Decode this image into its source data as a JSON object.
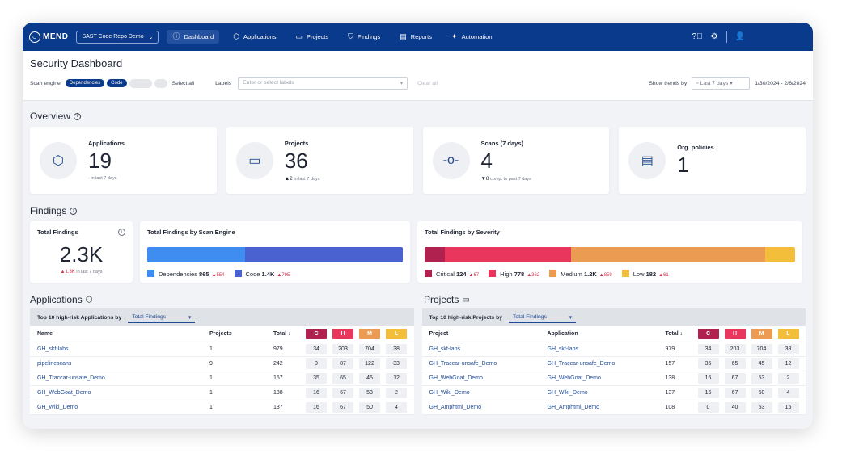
{
  "colors": {
    "brand": "#0a3a8c",
    "critical": "#b0214f",
    "high": "#e9365d",
    "medium": "#eb9b52",
    "low": "#f3bf3b",
    "dependencies": "#3f8df0",
    "code": "#4a62cf"
  },
  "topbar": {
    "logo_text": "MEND",
    "org_select": "SAST Code Repo Demo",
    "nav": [
      {
        "label": "Dashboard",
        "icon": "info-icon"
      },
      {
        "label": "Applications",
        "icon": "cube-icon"
      },
      {
        "label": "Projects",
        "icon": "folder-icon"
      },
      {
        "label": "Findings",
        "icon": "shield-icon"
      },
      {
        "label": "Reports",
        "icon": "report-icon"
      },
      {
        "label": "Automation",
        "icon": "sparkle-icon"
      }
    ]
  },
  "subheader": {
    "title": "Security Dashboard",
    "scan_engine_label": "Scan engine",
    "pill_dependencies": "Dependencies",
    "pill_code": "Code",
    "select_all": "Select all",
    "labels_label": "Labels",
    "labels_placeholder": "Enter or select labels",
    "clear_all": "Clear all",
    "show_trends_label": "Show trends by",
    "trend_value": "Last 7 days",
    "date_range": "1/30/2024 - 2/6/2024"
  },
  "overview": {
    "heading": "Overview",
    "cards": [
      {
        "label": "Applications",
        "value": "19",
        "sub": "- in last 7 days"
      },
      {
        "label": "Projects",
        "value": "36",
        "delta": "▲2",
        "sub": "in last 7 days"
      },
      {
        "label": "Scans (7 days)",
        "value": "4",
        "delta": "▼8",
        "sub": "comp. to past 7 days"
      },
      {
        "label": "Org. policies",
        "value": "1",
        "sub": ""
      }
    ]
  },
  "findings": {
    "heading": "Findings",
    "total_label": "Total Findings",
    "total_value": "2.3K",
    "total_delta": "▲1.3K",
    "total_sub": "in last 7 days",
    "by_engine_title": "Total Findings by Scan Engine",
    "engine": [
      {
        "name": "Dependencies",
        "value": "865",
        "delta": "▲554",
        "amount": 865
      },
      {
        "name": "Code",
        "value": "1.4K",
        "delta": "▲795",
        "amount": 1400
      }
    ],
    "by_severity_title": "Total Findings by Severity",
    "severity": [
      {
        "name": "Critical",
        "value": "124",
        "delta": "▲67",
        "amount": 124
      },
      {
        "name": "High",
        "value": "778",
        "delta": "▲362",
        "amount": 778
      },
      {
        "name": "Medium",
        "value": "1.2K",
        "delta": "▲859",
        "amount": 1200
      },
      {
        "name": "Low",
        "value": "182",
        "delta": "▲61",
        "amount": 182
      }
    ]
  },
  "applications": {
    "heading": "Applications",
    "top_label": "Top 10 high-risk Applications by",
    "select": "Total Findings",
    "headers": {
      "name": "Name",
      "projects": "Projects",
      "total": "Total ↓",
      "c": "C",
      "h": "H",
      "m": "M",
      "l": "L"
    },
    "rows": [
      {
        "name": "GH_skf-labs",
        "projects": "1",
        "total": "979",
        "c": "34",
        "h": "203",
        "m": "704",
        "l": "38"
      },
      {
        "name": "pipelinescans",
        "projects": "9",
        "total": "242",
        "c": "0",
        "h": "87",
        "m": "122",
        "l": "33"
      },
      {
        "name": "GH_Traccar-unsafe_Demo",
        "projects": "1",
        "total": "157",
        "c": "35",
        "h": "65",
        "m": "45",
        "l": "12"
      },
      {
        "name": "GH_WebGoat_Demo",
        "projects": "1",
        "total": "138",
        "c": "16",
        "h": "67",
        "m": "53",
        "l": "2"
      },
      {
        "name": "GH_Wiki_Demo",
        "projects": "1",
        "total": "137",
        "c": "16",
        "h": "67",
        "m": "50",
        "l": "4"
      }
    ]
  },
  "projects": {
    "heading": "Projects",
    "top_label": "Top 10 high-risk Projects by",
    "select": "Total Findings",
    "headers": {
      "project": "Project",
      "application": "Application",
      "total": "Total ↓",
      "c": "C",
      "h": "H",
      "m": "M",
      "l": "L"
    },
    "rows": [
      {
        "project": "GH_skf-labs",
        "application": "GH_skf-labs",
        "total": "979",
        "c": "34",
        "h": "203",
        "m": "704",
        "l": "38"
      },
      {
        "project": "GH_Traccar-unsafe_Demo",
        "application": "GH_Traccar-unsafe_Demo",
        "total": "157",
        "c": "35",
        "h": "65",
        "m": "45",
        "l": "12"
      },
      {
        "project": "GH_WebGoat_Demo",
        "application": "GH_WebGoat_Demo",
        "total": "138",
        "c": "16",
        "h": "67",
        "m": "53",
        "l": "2"
      },
      {
        "project": "GH_Wiki_Demo",
        "application": "GH_Wiki_Demo",
        "total": "137",
        "c": "16",
        "h": "67",
        "m": "50",
        "l": "4"
      },
      {
        "project": "GH_Amphtml_Demo",
        "application": "GH_Amphtml_Demo",
        "total": "108",
        "c": "0",
        "h": "40",
        "m": "53",
        "l": "15"
      }
    ]
  }
}
